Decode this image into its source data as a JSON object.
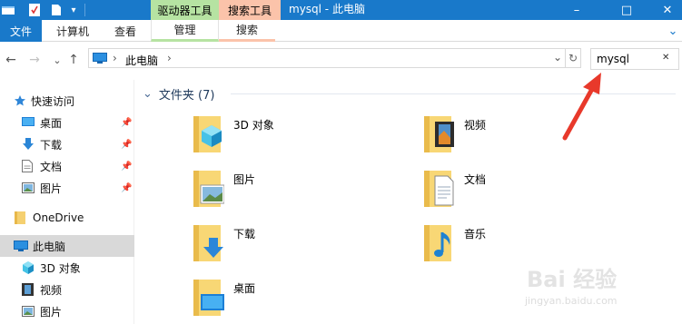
{
  "titlebar": {
    "window_title": "mysql - 此电脑",
    "context_tabs": [
      "驱动器工具",
      "搜索工具"
    ],
    "minimize": "–",
    "maximize": "□",
    "close": "✕"
  },
  "ribbon": {
    "file": "文件",
    "computer": "计算机",
    "view": "查看",
    "manage": "管理",
    "search": "搜索",
    "expand": "⌄"
  },
  "nav": {
    "back": "←",
    "forward": "→",
    "recent": "⌄",
    "up": "↑",
    "breadcrumb_sep1": "›",
    "location": "此电脑",
    "breadcrumb_sep2": "›",
    "dropdown": "⌄",
    "refresh": "↻"
  },
  "search": {
    "value": "mysql",
    "clear": "✕"
  },
  "sidebar": {
    "items": [
      {
        "label": "快速访问",
        "icon": "star-icon"
      },
      {
        "label": "桌面",
        "icon": "desktop-icon",
        "pinned": true
      },
      {
        "label": "下载",
        "icon": "download-icon",
        "pinned": true
      },
      {
        "label": "文档",
        "icon": "document-icon",
        "pinned": true
      },
      {
        "label": "图片",
        "icon": "picture-icon",
        "pinned": true
      },
      {
        "label": "OneDrive",
        "icon": "folder-icon"
      },
      {
        "label": "此电脑",
        "icon": "computer-icon",
        "selected": true
      },
      {
        "label": "3D 对象",
        "icon": "cube-icon"
      },
      {
        "label": "视频",
        "icon": "video-icon"
      },
      {
        "label": "图片",
        "icon": "picture-icon"
      }
    ]
  },
  "group": {
    "chevron": "⌄",
    "title": "文件夹 (7)"
  },
  "folders": [
    {
      "label": "3D 对象",
      "icon": "cube-icon"
    },
    {
      "label": "视频",
      "icon": "video-icon"
    },
    {
      "label": "图片",
      "icon": "picture-icon"
    },
    {
      "label": "文档",
      "icon": "document-icon"
    },
    {
      "label": "下载",
      "icon": "download-icon"
    },
    {
      "label": "音乐",
      "icon": "music-icon"
    },
    {
      "label": "桌面",
      "icon": "desktop-icon"
    }
  ],
  "watermark": {
    "brand": "Bai 经验",
    "url": "jingyan.baidu.com"
  },
  "colors": {
    "titlebar": "#1979ca",
    "drive_tools": "#b6e3a2",
    "search_tools": "#fbc3aa",
    "annotation_arrow": "#e8392b",
    "selected_row": "#d9d9d9"
  }
}
